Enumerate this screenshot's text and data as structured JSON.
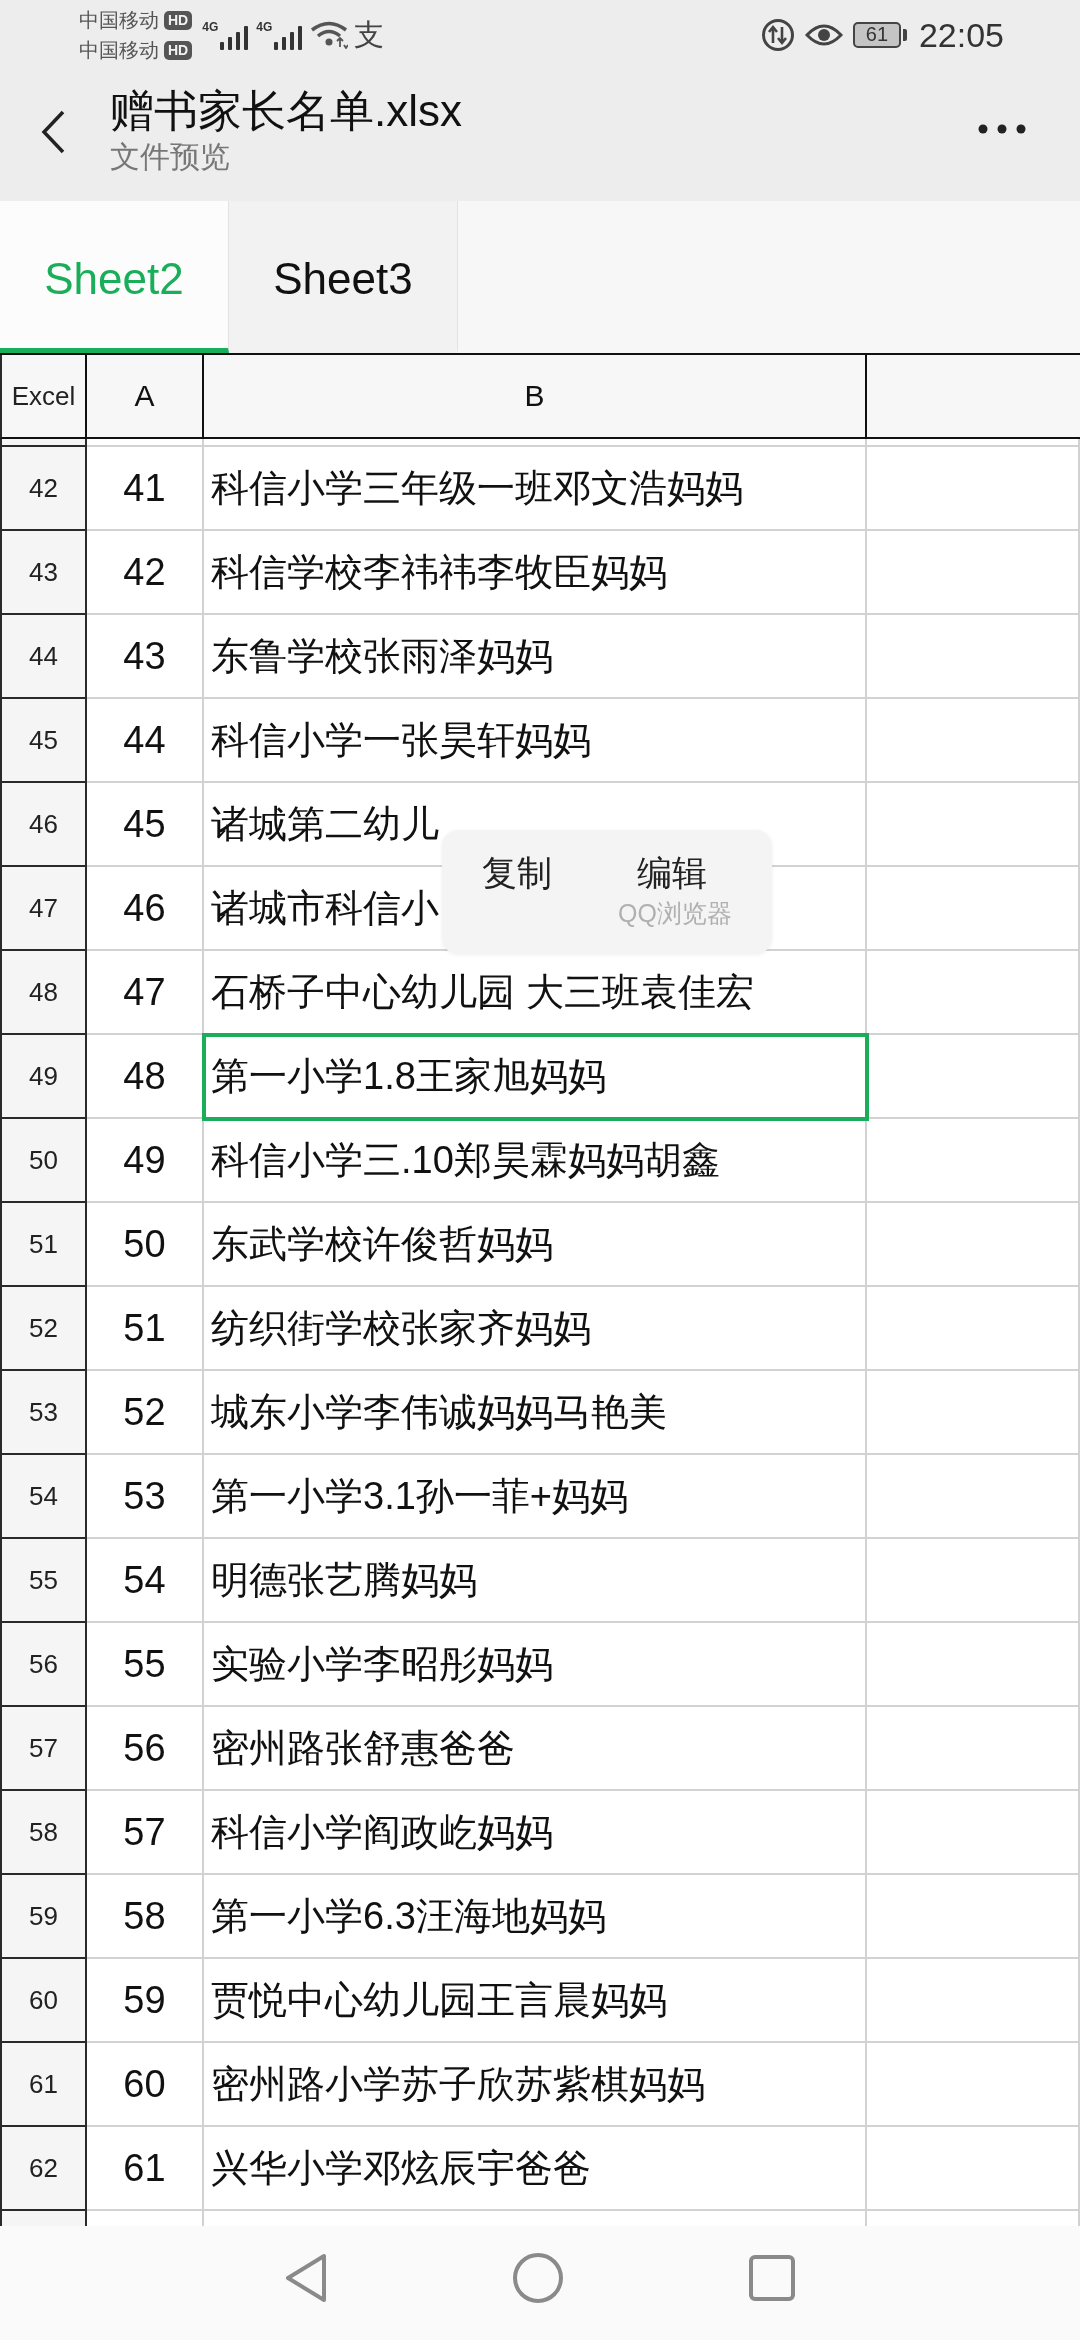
{
  "status_bar": {
    "carriers": [
      {
        "name": "中国移动",
        "badge": "HD"
      },
      {
        "name": "中国移动",
        "badge": "HD"
      }
    ],
    "network_labels": [
      "4G",
      "4G"
    ],
    "notification_glyph": "支",
    "battery": "61",
    "time": "22:05"
  },
  "header": {
    "title": "赠书家长名单.xlsx",
    "subtitle": "文件预览"
  },
  "tabs": [
    {
      "label": "Sheet2",
      "selected": true
    },
    {
      "label": "Sheet3",
      "selected": false
    }
  ],
  "table": {
    "corner": "Excel",
    "columns": [
      "A",
      "B"
    ],
    "rows": [
      {
        "number": "42",
        "a": "41",
        "b": "科信小学三年级一班邓文浩妈妈",
        "selected": false
      },
      {
        "number": "43",
        "a": "42",
        "b": "科信学校李祎祎李牧臣妈妈",
        "selected": false
      },
      {
        "number": "44",
        "a": "43",
        "b": "东鲁学校张雨泽妈妈",
        "selected": false
      },
      {
        "number": "45",
        "a": "44",
        "b": "科信小学一张昊轩妈妈",
        "selected": false
      },
      {
        "number": "46",
        "a": "45",
        "b": "诸城第二幼儿",
        "selected": false
      },
      {
        "number": "47",
        "a": "46",
        "b": "诸城市科信小",
        "selected": false
      },
      {
        "number": "48",
        "a": "47",
        "b": "石桥子中心幼儿园 大三班袁佳宏",
        "selected": false
      },
      {
        "number": "49",
        "a": "48",
        "b": "第一小学1.8王家旭妈妈",
        "selected": true
      },
      {
        "number": "50",
        "a": "49",
        "b": "科信小学三.10郑昊霖妈妈胡鑫",
        "selected": false
      },
      {
        "number": "51",
        "a": "50",
        "b": "东武学校许俊哲妈妈",
        "selected": false
      },
      {
        "number": "52",
        "a": "51",
        "b": "纺织街学校张家齐妈妈",
        "selected": false
      },
      {
        "number": "53",
        "a": "52",
        "b": "城东小学李伟诚妈妈马艳美",
        "selected": false
      },
      {
        "number": "54",
        "a": "53",
        "b": "第一小学3.1孙一菲+妈妈",
        "selected": false
      },
      {
        "number": "55",
        "a": "54",
        "b": "明德张艺腾妈妈",
        "selected": false
      },
      {
        "number": "56",
        "a": "55",
        "b": "实验小学李昭彤妈妈",
        "selected": false
      },
      {
        "number": "57",
        "a": "56",
        "b": "密州路张舒惠爸爸",
        "selected": false
      },
      {
        "number": "58",
        "a": "57",
        "b": "科信小学阎政屹妈妈",
        "selected": false
      },
      {
        "number": "59",
        "a": "58",
        "b": "第一小学6.3汪海地妈妈",
        "selected": false
      },
      {
        "number": "60",
        "a": "59",
        "b": "贾悦中心幼儿园王言晨妈妈",
        "selected": false
      },
      {
        "number": "61",
        "a": "60",
        "b": "密州路小学苏子欣苏紫棋妈妈",
        "selected": false
      },
      {
        "number": "62",
        "a": "61",
        "b": "兴华小学邓炫辰宇爸爸",
        "selected": false
      }
    ]
  },
  "context_menu": {
    "items": [
      "复制",
      "编辑"
    ],
    "source": "QQ浏览器"
  }
}
